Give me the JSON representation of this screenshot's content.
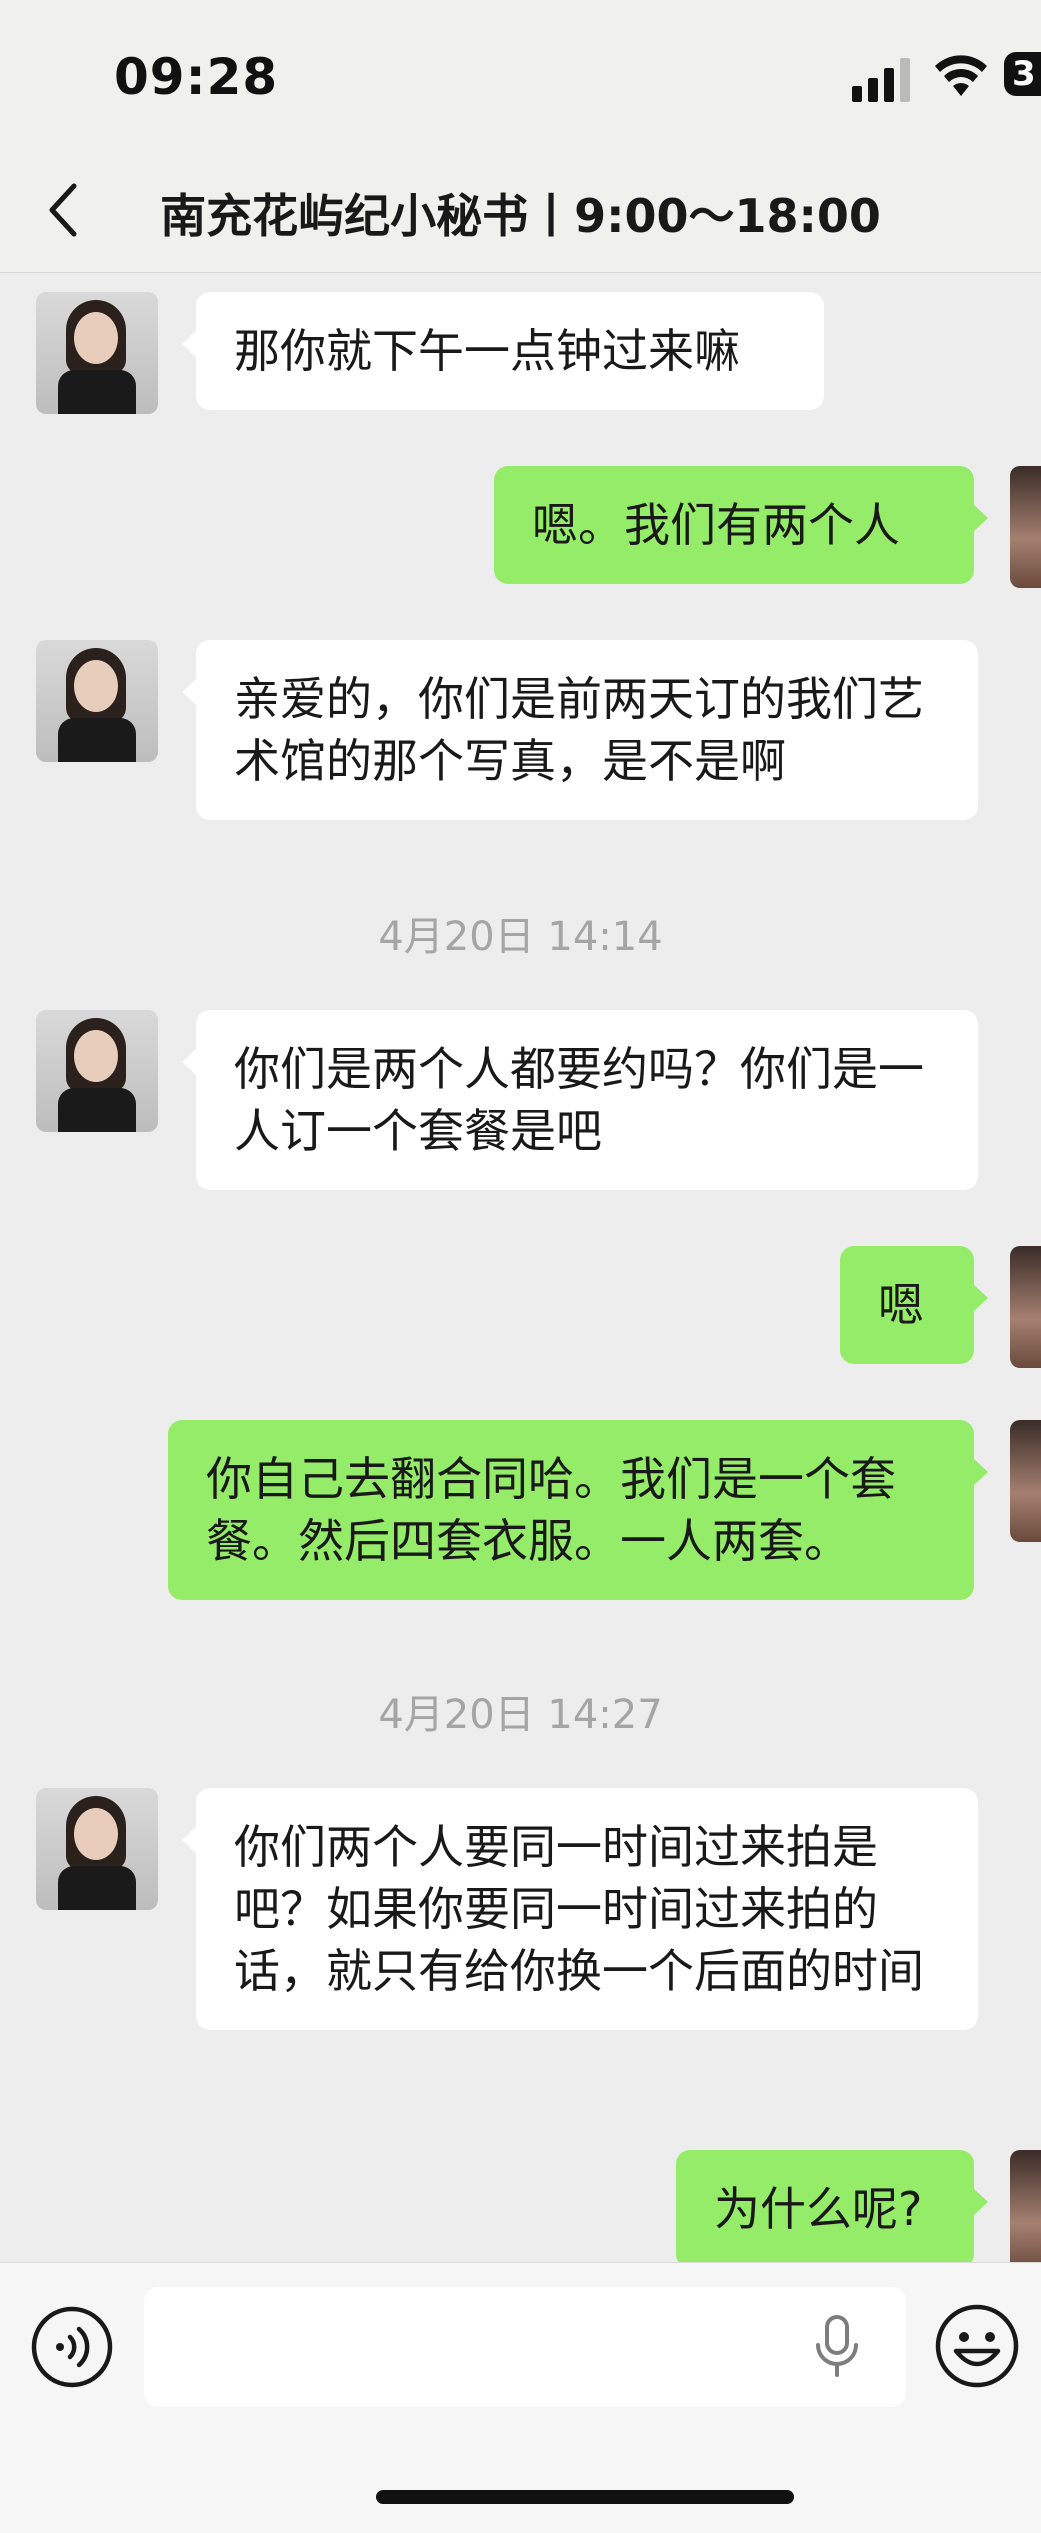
{
  "status_bar": {
    "time": "09:28",
    "battery": "3"
  },
  "header": {
    "title": "南充花屿纪小秘书丨9:00～18:00"
  },
  "messages": [
    {
      "type": "in",
      "text": "那你就下午一点钟过来嘛"
    },
    {
      "type": "out",
      "text": "嗯。我们有两个人"
    },
    {
      "type": "in",
      "text": "亲爱的，你们是前两天订的我们艺术馆的那个写真，是不是啊"
    },
    {
      "type": "time",
      "text": "4月20日 14:14"
    },
    {
      "type": "in",
      "text": "你们是两个人都要约吗？你们是一人订一个套餐是吧"
    },
    {
      "type": "out",
      "text": "嗯"
    },
    {
      "type": "out",
      "text": "你自己去翻合同哈。我们是一个套餐。然后四套衣服。一人两套。"
    },
    {
      "type": "time",
      "text": "4月20日 14:27"
    },
    {
      "type": "in",
      "text": "你们两个人要同一时间过来拍是吧？如果你要同一时间过来拍的话，就只有给你换一个后面的时间"
    },
    {
      "type": "out",
      "text": "为什么呢?"
    }
  ],
  "input": {
    "value": ""
  },
  "icons": {
    "back": "chevron-left-icon",
    "voice": "voice-mode-icon",
    "mic": "microphone-icon",
    "emoji": "emoji-icon"
  },
  "colors": {
    "outgoing_bubble": "#95ec69",
    "incoming_bubble": "#ffffff",
    "background": "#ededed"
  }
}
